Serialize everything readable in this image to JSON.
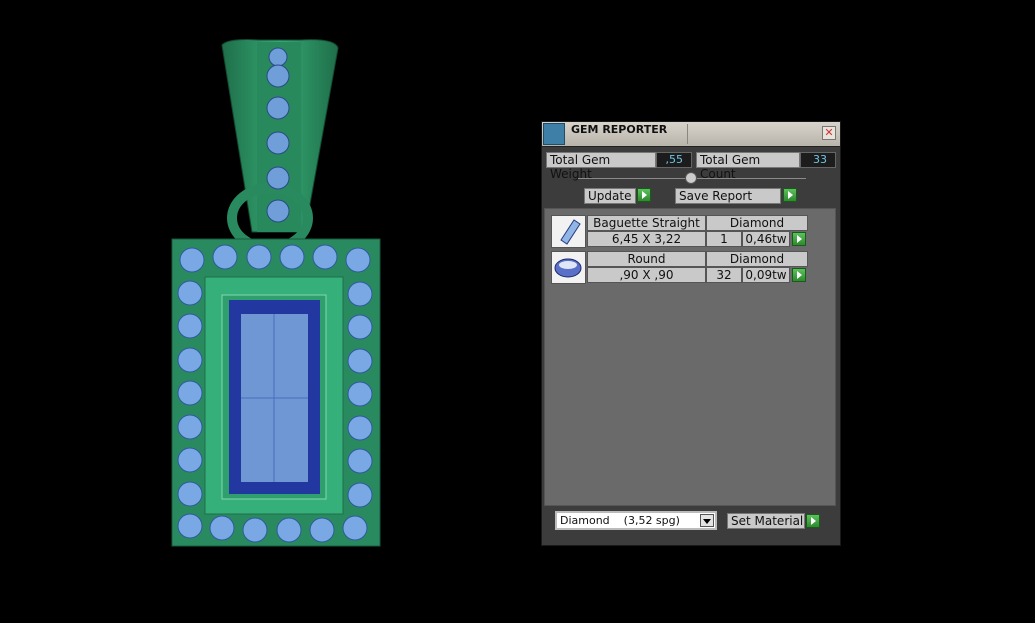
{
  "panel": {
    "title": "GEM REPORTER",
    "close_icon": "close-icon",
    "total_weight_label": "Total Gem Weight",
    "total_weight_value": ",55",
    "total_count_label": "Total Gem Count",
    "total_count_value": "33",
    "update_label": "Update",
    "save_label": "Save Report",
    "gems": [
      {
        "shape": "Baguette Straight",
        "material": "Diamond",
        "size": "6,45 X 3,22",
        "count": "1",
        "weight": "0,46tw",
        "icon": "baguette-gem-icon"
      },
      {
        "shape": "Round",
        "material": "Diamond",
        "size": ",90 X ,90",
        "count": "32",
        "weight": "0,09tw",
        "icon": "round-gem-icon"
      }
    ],
    "material_select": "Diamond    (3,52 spg)",
    "set_material_label": "Set Material"
  },
  "colors": {
    "metal": "#2a8a5f",
    "stone": "#6f9ed8",
    "center_stone": "#2b3ea8",
    "value_text": "#6ec6e8"
  }
}
